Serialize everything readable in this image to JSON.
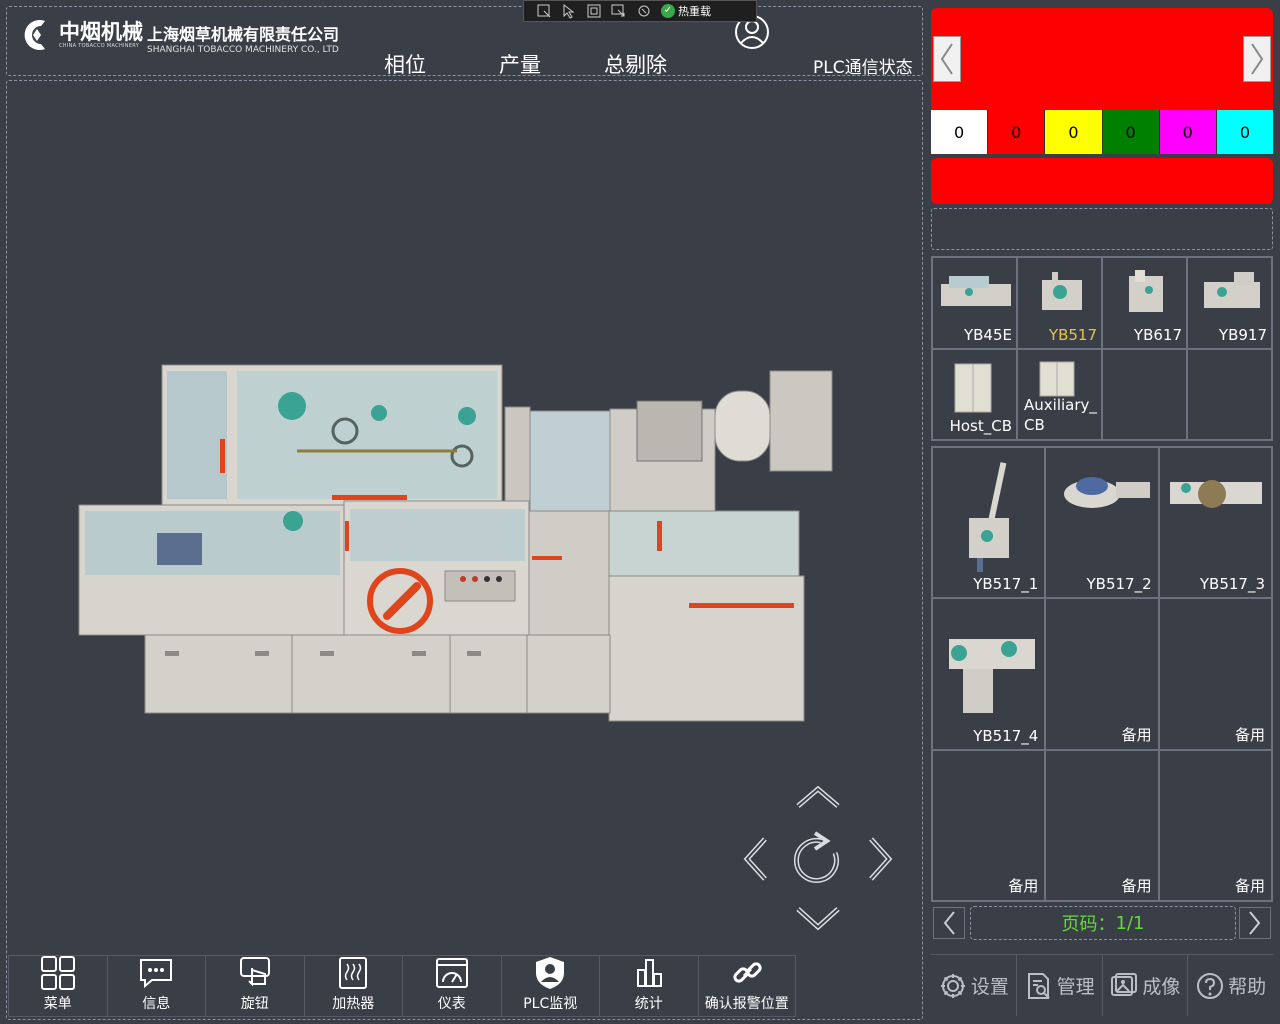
{
  "devbar": {
    "hot_reload_label": "热重载"
  },
  "header": {
    "logo_cn": "中烟机械",
    "logo_en": "CHINA TOBACCO MACHINERY",
    "company_cn": "上海烟草机械有限责任公司",
    "company_en": "SHANGHAI TOBACCO MACHINERY CO., LTD",
    "nav": [
      "相位",
      "产量",
      "总剔除",
      "PLC通信状态"
    ]
  },
  "alarm_counts": [
    {
      "value": "0",
      "color": "#ffffff"
    },
    {
      "value": "0",
      "color": "#ff0000"
    },
    {
      "value": "0",
      "color": "#ffff00"
    },
    {
      "value": "0",
      "color": "#008000"
    },
    {
      "value": "0",
      "color": "#ff00ff"
    },
    {
      "value": "0",
      "color": "#00ffff"
    }
  ],
  "models": [
    "YB45E",
    "YB517",
    "YB617",
    "YB917",
    "Host_CB",
    "Auxiliary_\nCB",
    "",
    ""
  ],
  "selected_model": "YB517",
  "parts": [
    "YB517_1",
    "YB517_2",
    "YB517_3",
    "YB517_4",
    "备用",
    "备用",
    "备用",
    "备用",
    "备用"
  ],
  "pager": {
    "label": "页码：",
    "value": "1/1"
  },
  "bottom_menu": [
    "菜单",
    "信息",
    "旋钮",
    "加热器",
    "仪表",
    "PLC监视",
    "统计",
    "确认报警位置"
  ],
  "right_menu": [
    "设置",
    "管理",
    "成像",
    "帮助"
  ],
  "colors": {
    "alarm": "#ff0000",
    "accent_green": "#64d73e",
    "selected": "#e6c44a",
    "bg": "#3a3f47"
  }
}
